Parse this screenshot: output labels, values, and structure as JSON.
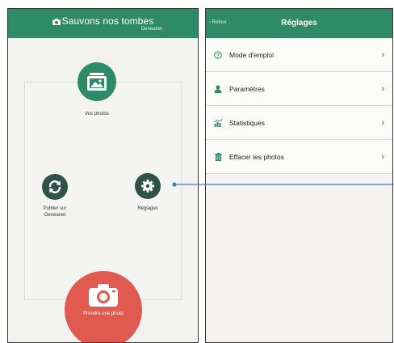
{
  "left_screen": {
    "app_title": "Sauvons nos tombes",
    "app_subtitle": "Geneanet",
    "photos_label": "Vos photos",
    "publish_label": "Publier sur Geneanet",
    "settings_label": "Réglages",
    "camera_label": "Prendre une photo"
  },
  "right_screen": {
    "back_label": "Retour",
    "title": "Réglages",
    "menu": [
      {
        "label": "Mode d'emploi",
        "icon": "help-icon"
      },
      {
        "label": "Paramètres",
        "icon": "user-icon"
      },
      {
        "label": "Statistiques",
        "icon": "stats-icon"
      },
      {
        "label": "Effacer les photos",
        "icon": "trash-icon"
      }
    ]
  },
  "colors": {
    "header_green": "#2e8a67",
    "button_dark_green": "#2e5247",
    "camera_red": "#e05a4f",
    "connector_blue": "#3a82c4"
  }
}
